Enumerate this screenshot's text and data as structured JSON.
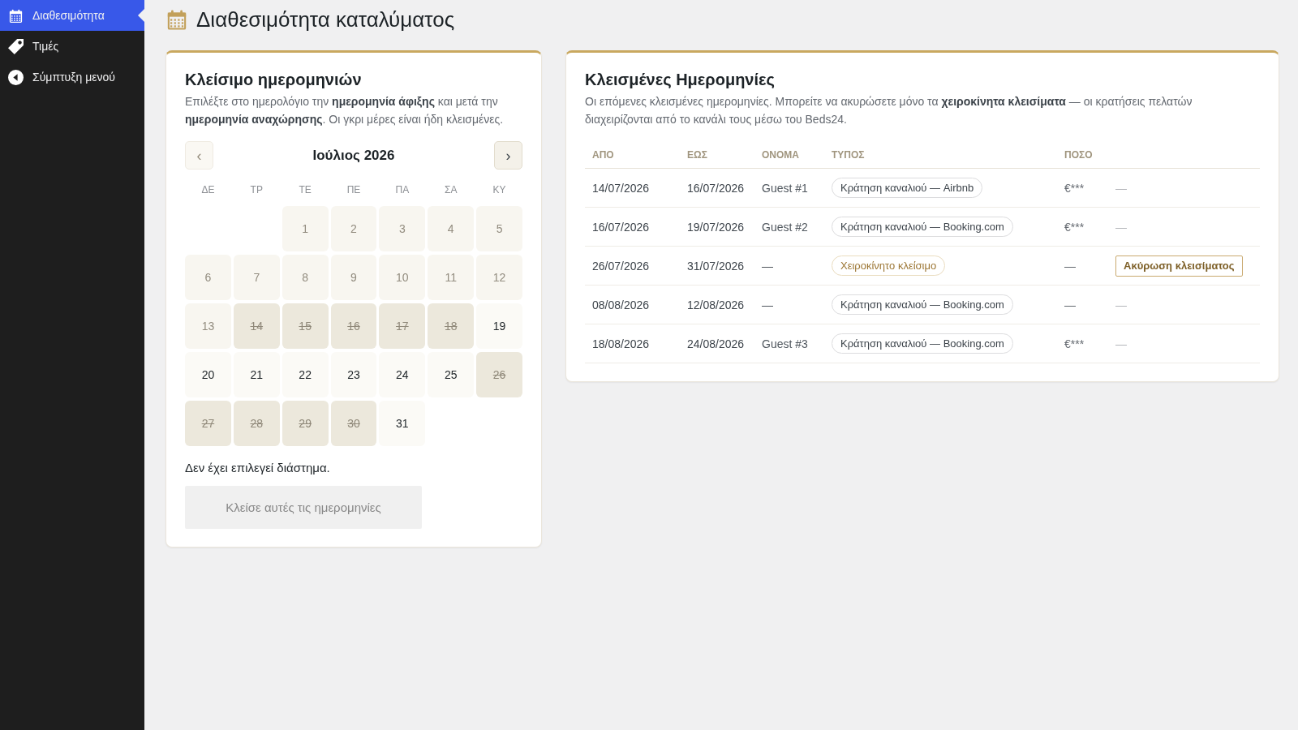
{
  "sidebar": {
    "items": [
      {
        "label": "Διαθεσιμότητα",
        "selected": true
      },
      {
        "label": "Τιμές",
        "selected": false
      },
      {
        "label": "Σύμπτυξη μενού",
        "selected": false
      }
    ]
  },
  "page": {
    "title": "Διαθεσιμότητα καταλύματος"
  },
  "booking_card": {
    "title": "Κλείσιμο ημερομηνιών",
    "description": "Επιλέξτε στο ημερολόγιο την **ημερομηνία άφιξης** και μετά την **ημερομηνία αναχώρησης**. Οι γκρι μέρες είναι ήδη κλεισμένες.",
    "calendar": {
      "month": "Ιούλιος 2026",
      "prev": {
        "label": "‹",
        "disabled": true
      },
      "next": {
        "label": "›",
        "disabled": false
      },
      "weekdays": [
        "ΔΕ",
        "ΤΡ",
        "ΤΕ",
        "ΠΕ",
        "ΠΑ",
        "ΣΑ",
        "ΚΥ"
      ],
      "weeks": [
        [
          {
            "day": "1",
            "disabled": true,
            "closed": false
          },
          {
            "day": "2",
            "disabled": true,
            "closed": false
          },
          {
            "day": "3",
            "disabled": true,
            "closed": false
          },
          {
            "day": "4",
            "disabled": true,
            "closed": false
          },
          {
            "day": "5",
            "disabled": true,
            "closed": false
          }
        ],
        [
          {
            "day": "6",
            "disabled": true,
            "closed": false
          },
          {
            "day": "7",
            "disabled": true,
            "closed": false
          },
          {
            "day": "8",
            "disabled": true,
            "closed": false
          },
          {
            "day": "9",
            "disabled": true,
            "closed": false
          },
          {
            "day": "10",
            "disabled": true,
            "closed": false
          },
          {
            "day": "11",
            "disabled": true,
            "closed": false
          },
          {
            "day": "12",
            "disabled": true,
            "closed": false
          }
        ],
        [
          {
            "day": "13",
            "disabled": true,
            "closed": false
          },
          {
            "day": "14",
            "disabled": false,
            "closed": true
          },
          {
            "day": "15",
            "disabled": false,
            "closed": true
          },
          {
            "day": "16",
            "disabled": false,
            "closed": true
          },
          {
            "day": "17",
            "disabled": false,
            "closed": true
          },
          {
            "day": "18",
            "disabled": false,
            "closed": true
          },
          {
            "day": "19",
            "disabled": false,
            "closed": false
          }
        ],
        [
          {
            "day": "20",
            "disabled": false,
            "closed": false
          },
          {
            "day": "21",
            "disabled": false,
            "closed": false
          },
          {
            "day": "22",
            "disabled": false,
            "closed": false
          },
          {
            "day": "23",
            "disabled": false,
            "closed": false
          },
          {
            "day": "24",
            "disabled": false,
            "closed": false
          },
          {
            "day": "25",
            "disabled": false,
            "closed": false
          },
          {
            "day": "26",
            "disabled": false,
            "closed": true
          }
        ],
        [
          {
            "day": "27",
            "disabled": false,
            "closed": true
          },
          {
            "day": "28",
            "disabled": false,
            "closed": true
          },
          {
            "day": "29",
            "disabled": false,
            "closed": true
          },
          {
            "day": "30",
            "disabled": false,
            "closed": true
          },
          {
            "day": "31",
            "disabled": false,
            "closed": false
          }
        ]
      ]
    },
    "status": "Δεν έχει επιλεγεί διάστημα.",
    "submit": {
      "label": "Κλείσε αυτές τις ημερομηνίες",
      "disabled": true
    }
  },
  "closed_card": {
    "title": "Κλεισμένες Ημερομηνίες",
    "description": "Οι επόμενες κλεισμένες ημερομηνίες. Μπορείτε να ακυρώσετε μόνο τα **χειροκίνητα κλεισίματα** — οι κρατήσεις πελατών διαχειρίζονται από το κανάλι τους μέσω του Beds24.",
    "table": {
      "columns": [
        "ΑΠΟ",
        "ΕΩΣ",
        "ΟΝΟΜΑ",
        "ΤΥΠΟΣ",
        "ΠΟΣΟ"
      ],
      "rows": [
        {
          "from": "14/07/2026",
          "to": "16/07/2026",
          "name": "Guest #1",
          "type": {
            "label": "Κράτηση καναλιού — Airbnb",
            "kind": "channel"
          },
          "amount": "€***",
          "action": {
            "kind": "none",
            "text": "—"
          }
        },
        {
          "from": "16/07/2026",
          "to": "19/07/2026",
          "name": "Guest #2",
          "type": {
            "label": "Κράτηση καναλιού — Booking.com",
            "kind": "channel"
          },
          "amount": "€***",
          "action": {
            "kind": "none",
            "text": "—"
          }
        },
        {
          "from": "26/07/2026",
          "to": "31/07/2026",
          "name": "—",
          "type": {
            "label": "Χειροκίνητο κλείσιμο",
            "kind": "manual"
          },
          "amount": "—",
          "action": {
            "kind": "button",
            "label": "Ακύρωση κλεισίματος"
          }
        },
        {
          "from": "08/08/2026",
          "to": "12/08/2026",
          "name": "—",
          "type": {
            "label": "Κράτηση καναλιού — Booking.com",
            "kind": "channel"
          },
          "amount": "—",
          "action": {
            "kind": "none",
            "text": "—"
          }
        },
        {
          "from": "18/08/2026",
          "to": "24/08/2026",
          "name": "Guest #3",
          "type": {
            "label": "Κράτηση καναλιού — Booking.com",
            "kind": "channel"
          },
          "amount": "€***",
          "action": {
            "kind": "none",
            "text": "—"
          }
        }
      ]
    }
  }
}
